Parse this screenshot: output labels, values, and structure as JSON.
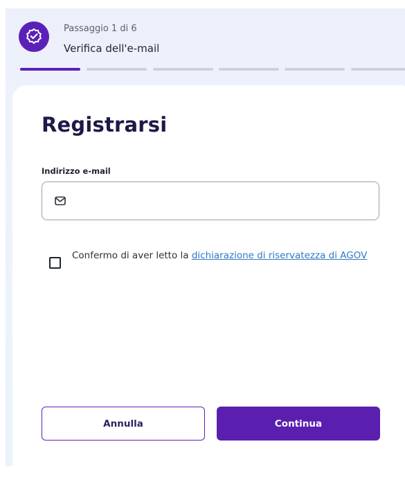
{
  "step": {
    "label": "Passaggio  1 di 6",
    "title": "Verifica dell'e-mail",
    "total_steps": 6,
    "current_step": 1
  },
  "form": {
    "title": "Registrarsi",
    "email_label": "Indirizzo e-mail",
    "email_value": "",
    "consent_text": "Confermo di aver letto la ",
    "consent_link": "dichiarazione di riservatezza di AGOV",
    "consent_checked": false
  },
  "buttons": {
    "cancel": "Annulla",
    "continue": "Continua"
  },
  "colors": {
    "accent": "#5b21b6",
    "link": "#2f78c4",
    "inactive_progress": "#cdd1d8"
  },
  "icons": {
    "step_badge": "check-badge-icon",
    "email": "mail-icon"
  }
}
